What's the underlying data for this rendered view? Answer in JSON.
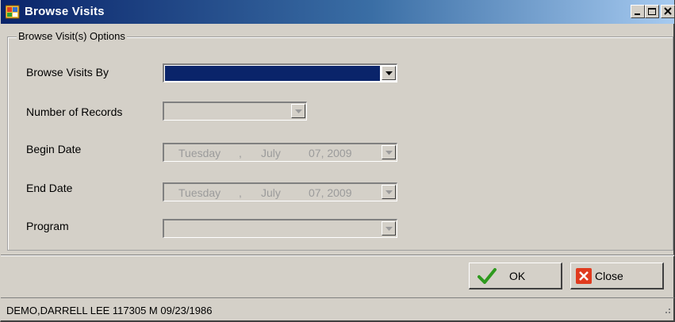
{
  "window": {
    "title": "Browse Visits",
    "title_bar_color": "#0a246a",
    "icons": [
      "app-icon",
      "minimize-icon",
      "maximize-icon",
      "close-icon"
    ]
  },
  "group": {
    "legend": "Browse Visit(s) Options"
  },
  "fields": {
    "browse_by": {
      "label": "Browse Visits By",
      "value": ""
    },
    "num_records": {
      "label": "Number of Records",
      "value": ""
    },
    "begin_date": {
      "label": "Begin Date",
      "weekday": "Tuesday",
      "sep": ",",
      "month": "July",
      "day_year": "07, 2009"
    },
    "end_date": {
      "label": "End Date",
      "weekday": "Tuesday",
      "sep": ",",
      "month": "July",
      "day_year": "07, 2009"
    },
    "program": {
      "label": "Program",
      "value": ""
    }
  },
  "buttons": {
    "ok_label": "OK",
    "close_label": "Close",
    "ok_icon": "checkmark-icon",
    "close_icon": "red-x-icon"
  },
  "status": {
    "patient": "DEMO,DARRELL LEE  117305  M  09/23/1986"
  },
  "colors": {
    "selection": "#0a246a",
    "disabled_text": "#9b9b9b",
    "face": "#d4d0c8"
  }
}
